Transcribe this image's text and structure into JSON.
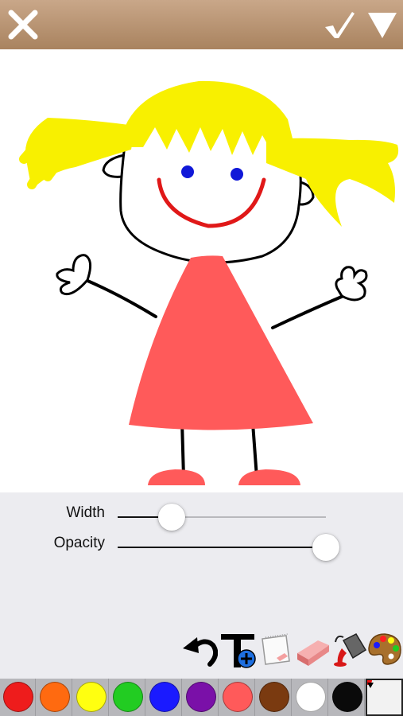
{
  "top_bar": {
    "close_icon": "close-icon",
    "done_icon": "checkmark-icon",
    "menu_icon": "dropdown-triangle-icon"
  },
  "sliders": {
    "width": {
      "label": "Width",
      "value": 0.26
    },
    "opacity": {
      "label": "Opacity",
      "value": 1.0
    }
  },
  "tools": [
    "undo-icon",
    "add-text-icon",
    "paper-icon",
    "eraser-icon",
    "paint-bucket-icon",
    "palette-icon"
  ],
  "palette": {
    "colors": [
      "#ee1c1c",
      "#ff6a10",
      "#ffff10",
      "#22cc22",
      "#1a1aff",
      "#7a10a8",
      "#ff5a5a",
      "#7a3a10",
      "#ffffff",
      "#0a0a0a"
    ],
    "current_color": "#f2f2f2"
  }
}
